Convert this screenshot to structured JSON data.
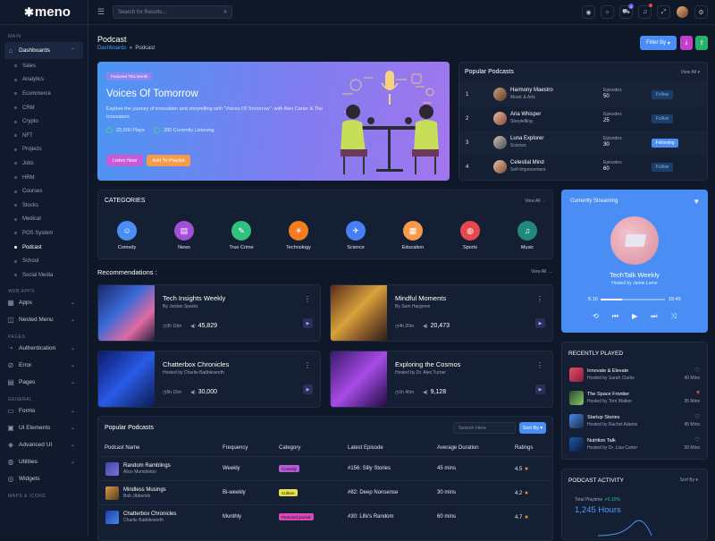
{
  "app": {
    "logo": "meno",
    "page_title": "Podcast"
  },
  "breadcrumb": {
    "parent": "Dashboards",
    "sep": "»",
    "current": "Podcast"
  },
  "search": {
    "placeholder": "Search for Results..."
  },
  "topbar": {
    "cart_badge": "4"
  },
  "sidebar": {
    "main_label": "MAIN",
    "dashboards": "Dashboards",
    "subs": [
      "Sales",
      "Analytics",
      "Ecommerce",
      "CRM",
      "Crypto",
      "NFT",
      "Projects",
      "Jobs",
      "HRM",
      "Courses",
      "Stocks",
      "Medical",
      "POS System",
      "Podcast",
      "School",
      "Social Media"
    ],
    "webapps_label": "WEB APPS",
    "apps": "Apps",
    "nested": "Nested Menu",
    "pages_label": "PAGES",
    "auth": "Authentication",
    "error": "Error",
    "pages": "Pages",
    "general_label": "GENERAL",
    "forms": "Forms",
    "ui": "UI Elements",
    "advui": "Advanced UI",
    "utilities": "Utilities",
    "widgets": "Widgets",
    "maps_label": "MAPS & ICONS"
  },
  "actions": {
    "filter": "Filter By"
  },
  "hero": {
    "tag": "Featured This Month",
    "title": "Voices Of Tomorrow",
    "desc": "Explore the journey of innovation and storytelling with \"Voices Of Tomorrow\", with Alex Carter & The Innovators",
    "plays": "22,500 Plays",
    "listening": "350 Currently Listening",
    "listen": "Listen Now",
    "add": "Add To Playlist"
  },
  "popular": {
    "title": "Popular Podcasts",
    "view_all": "View All",
    "episodes_label": "Episodes",
    "rows": [
      {
        "rank": "1",
        "name": "Harmony Maestro",
        "genre": "Music & Arts",
        "episodes": "50",
        "btn": "Follow"
      },
      {
        "rank": "2",
        "name": "Aria Whisper",
        "genre": "Storytelling",
        "episodes": "25",
        "btn": "Follow"
      },
      {
        "rank": "3",
        "name": "Luna Explorer",
        "genre": "Science",
        "episodes": "30",
        "btn": "Following"
      },
      {
        "rank": "4",
        "name": "Celestial Mind",
        "genre": "Self-Improvement",
        "episodes": "60",
        "btn": "Follow"
      }
    ]
  },
  "categories": {
    "title": "CATEGORIES",
    "view_all": "View All",
    "items": [
      "Comedy",
      "News",
      "True Crime",
      "Technology",
      "Science",
      "Education",
      "Sports",
      "Music"
    ]
  },
  "recommendations": {
    "title": "Recommendations :",
    "view_all": "View All",
    "items": [
      {
        "title": "Tech Insights Weekly",
        "by": "By Jordan Sparks",
        "dur": "3h 10m",
        "plays": "45,829"
      },
      {
        "title": "Mindful Moments",
        "by": "By Sam Hargrove",
        "dur": "4h 20m",
        "plays": "20,473"
      },
      {
        "title": "Chatterbox Chronicles",
        "by": "Hosted by Charlie Babbleworth",
        "dur": "5h 15m",
        "plays": "30,000"
      },
      {
        "title": "Exploring the Cosmos",
        "by": "Hosted by Dr. Alex Turner",
        "dur": "1h 45m",
        "plays": "9,128"
      }
    ]
  },
  "table": {
    "title": "Popular Podcasts",
    "search_placeholder": "Search Here",
    "sort": "Sort By",
    "headers": [
      "Podcast Name",
      "Frequency",
      "Category",
      "Latest Episode",
      "Average Duration",
      "Ratings"
    ],
    "rows": [
      {
        "name": "Random Ramblings",
        "host": "Alice Mumbleton",
        "freq": "Weekly",
        "cat": "Comedy",
        "ep": "#156: Silly Stories",
        "dur": "45 mins",
        "rating": "4.5"
      },
      {
        "name": "Mindless Musings",
        "host": "Bob Jibberish",
        "freq": "Bi-weekly",
        "cat": "Culture",
        "ep": "#82: Deep Nonsense",
        "dur": "30 mins",
        "rating": "4.2"
      },
      {
        "name": "Chatterbox Chronicles",
        "host": "Charlie Babbleworth",
        "freq": "Monthly",
        "cat": "Personal journal",
        "ep": "#30: Life's Random",
        "dur": "60 mins",
        "rating": "4.7"
      }
    ]
  },
  "streaming": {
    "title": "Currently Streaming",
    "track": "TechTalk Weekly",
    "host": "Hosted by Jamie Lorne",
    "elapsed": "5:10",
    "total": "15:45",
    "progress": 0.33
  },
  "recent": {
    "title": "RECENTLY PLAYED",
    "items": [
      {
        "title": "Innovate & Elevate",
        "host": "Hosted by Sarah Clarke",
        "dur": "40 Mins",
        "liked": false
      },
      {
        "title": "The Space Frontier",
        "host": "Hosted by Tom Walker",
        "dur": "35 Mins",
        "liked": true
      },
      {
        "title": "Startup Stories",
        "host": "Hosted by Rachel Adams",
        "dur": "45 Mins",
        "liked": false
      },
      {
        "title": "Nutrition Talk",
        "host": "Hosted by Dr. Lisa Carter",
        "dur": "50 Mins",
        "liked": false
      }
    ]
  },
  "activity": {
    "title": "PODCAST ACTIVITY",
    "sort": "Sort By",
    "label": "Total Playtime",
    "change": "5.10%",
    "value": "1,245 Hours"
  }
}
